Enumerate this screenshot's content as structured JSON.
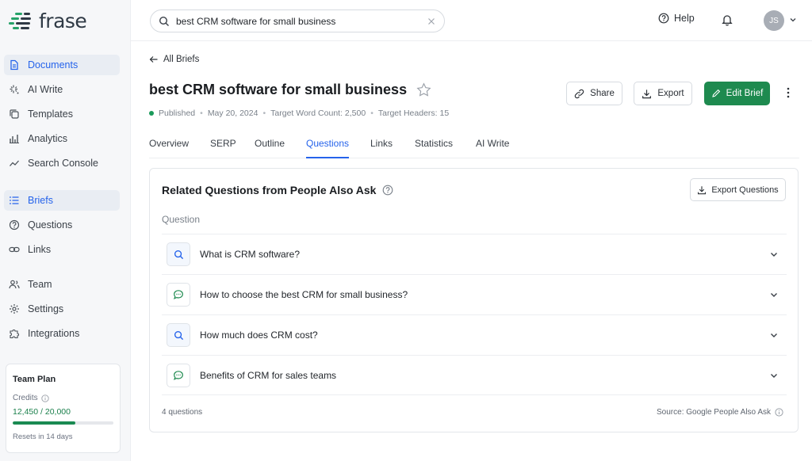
{
  "brand": {
    "name": "frase"
  },
  "sidebar": {
    "items": [
      {
        "label": "Documents",
        "icon": "document-icon",
        "active": true
      },
      {
        "label": "AI Write",
        "icon": "sparkle-icon",
        "active": false
      },
      {
        "label": "Templates",
        "icon": "copy-icon",
        "active": false
      },
      {
        "label": "Analytics",
        "icon": "bar-chart-icon",
        "active": false
      },
      {
        "label": "Search Console",
        "icon": "trend-line-icon",
        "active": false
      },
      {
        "label": "Briefs",
        "icon": "list-icon",
        "active": true
      },
      {
        "label": "Questions",
        "icon": "question-circle-icon",
        "active": false
      },
      {
        "label": "Links",
        "icon": "link-icon",
        "active": false
      },
      {
        "label": "Team",
        "icon": "users-icon",
        "active": false
      },
      {
        "label": "Settings",
        "icon": "gear-icon",
        "active": false
      },
      {
        "label": "Integrations",
        "icon": "puzzle-icon",
        "active": false
      }
    ],
    "plan": {
      "title": "Team Plan",
      "credits_label": "Credits",
      "credits_value": "12,450 / 20,000",
      "credits_fraction": 0.6225,
      "reset_text": "Resets in 14 days"
    }
  },
  "topbar": {
    "search_value": "best CRM software for small business",
    "help_label": "Help",
    "avatar_initials": "JS"
  },
  "main": {
    "back_label": "All Briefs",
    "title": "best CRM software for small business",
    "meta": {
      "status": "Published",
      "date": "May 20, 2024",
      "word_count": "Target Word Count: 2,500",
      "headers": "Target Headers: 15"
    },
    "actions": {
      "share": "Share",
      "export": "Export",
      "edit": "Edit Brief"
    },
    "tabs": [
      {
        "label": "Overview",
        "active": false
      },
      {
        "label": "SERP",
        "active": false
      },
      {
        "label": "Outline",
        "active": false
      },
      {
        "label": "Questions",
        "active": true
      },
      {
        "label": "Links",
        "active": false
      },
      {
        "label": "Statistics",
        "active": false
      },
      {
        "label": "AI Write",
        "active": false
      }
    ],
    "panel": {
      "title": "Related Questions from People Also Ask",
      "export_label": "Export Questions",
      "column_header": "Question",
      "questions": [
        {
          "text": "What is CRM software?",
          "icon": "search-icon"
        },
        {
          "text": "How to choose the best CRM for small business?",
          "icon": "chat-bubble-icon"
        },
        {
          "text": "How much does CRM cost?",
          "icon": "search-icon"
        },
        {
          "text": "Benefits of CRM for sales teams",
          "icon": "chat-bubble-icon"
        }
      ],
      "count_text": "4 questions",
      "source_text": "Source: Google People Also Ask"
    }
  },
  "colors": {
    "accent": "#2563eb",
    "primary_green": "#1e8a4f",
    "success": "#1a9a5a"
  }
}
